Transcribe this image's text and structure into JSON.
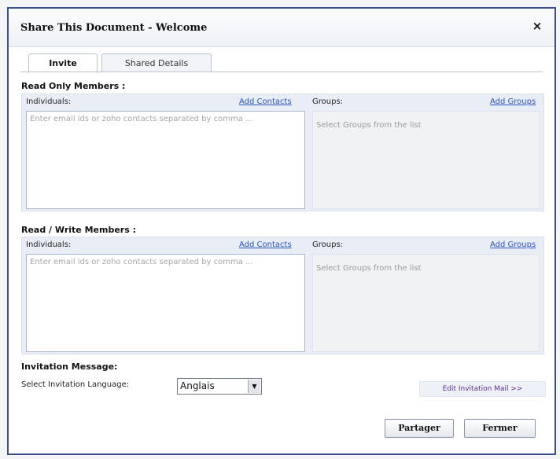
{
  "dialog": {
    "title": "Share This Document - Welcome",
    "close_label": "×"
  },
  "tabs": [
    {
      "label": "Invite",
      "active": true
    },
    {
      "label": "Shared Details",
      "active": false
    }
  ],
  "read_only": {
    "title": "Read Only Members :",
    "individuals_label": "Individuals:",
    "add_contacts_label": "Add Contacts",
    "groups_label": "Groups:",
    "add_groups_label": "Add Groups",
    "email_placeholder": "Enter email ids or zoho contacts separated by comma ...",
    "groups_placeholder": "Select Groups from the list"
  },
  "read_write": {
    "title": "Read / Write Members :",
    "individuals_label": "Individuals:",
    "add_contacts_label": "Add Contacts",
    "groups_label": "Groups:",
    "add_groups_label": "Add Groups",
    "email_placeholder": "Enter email ids or zoho contacts separated by comma ...",
    "groups_placeholder": "Select Groups from the list"
  },
  "invitation": {
    "title": "Invitation Message:",
    "language_label": "Select Invitation Language:",
    "language_value": "Anglais",
    "edit_mail_label": "Edit Invitation Mail >>"
  },
  "buttons": {
    "share": "Partager",
    "close": "Fermer"
  },
  "colors": {
    "dialog_border": "#3b4f8f",
    "link": "#2a52be",
    "panel_bg": "#e9eef6"
  }
}
